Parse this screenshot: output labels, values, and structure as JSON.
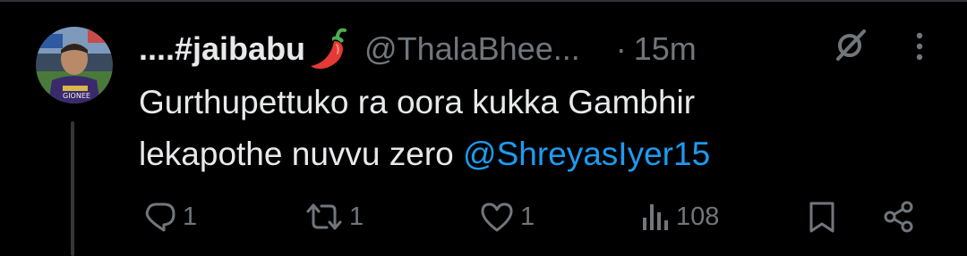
{
  "tweet": {
    "display_name": "....#jaibabu",
    "handle": "@ThalaBhee...",
    "separator": "·",
    "time": "15m",
    "text_line1": "Gurthupettuko ra oora kukka Gambhir",
    "text_line2_prefix": "lekapothe nuvvu zero ",
    "mention": "@ShreyasIyer15"
  },
  "actions": {
    "reply_count": "1",
    "repost_count": "1",
    "like_count": "1",
    "views_count": "108"
  },
  "icons": {
    "emoji": "hot-pepper",
    "grok": "grok-icon",
    "more": "more-vertical-icon",
    "reply": "reply-icon",
    "repost": "repost-icon",
    "like": "heart-icon",
    "views": "views-icon",
    "bookmark": "bookmark-icon",
    "share": "share-icon"
  },
  "colors": {
    "background": "#000000",
    "text": "#e7e9ea",
    "secondary": "#71767b",
    "link": "#1d9bf0",
    "divider": "#2f3336"
  }
}
